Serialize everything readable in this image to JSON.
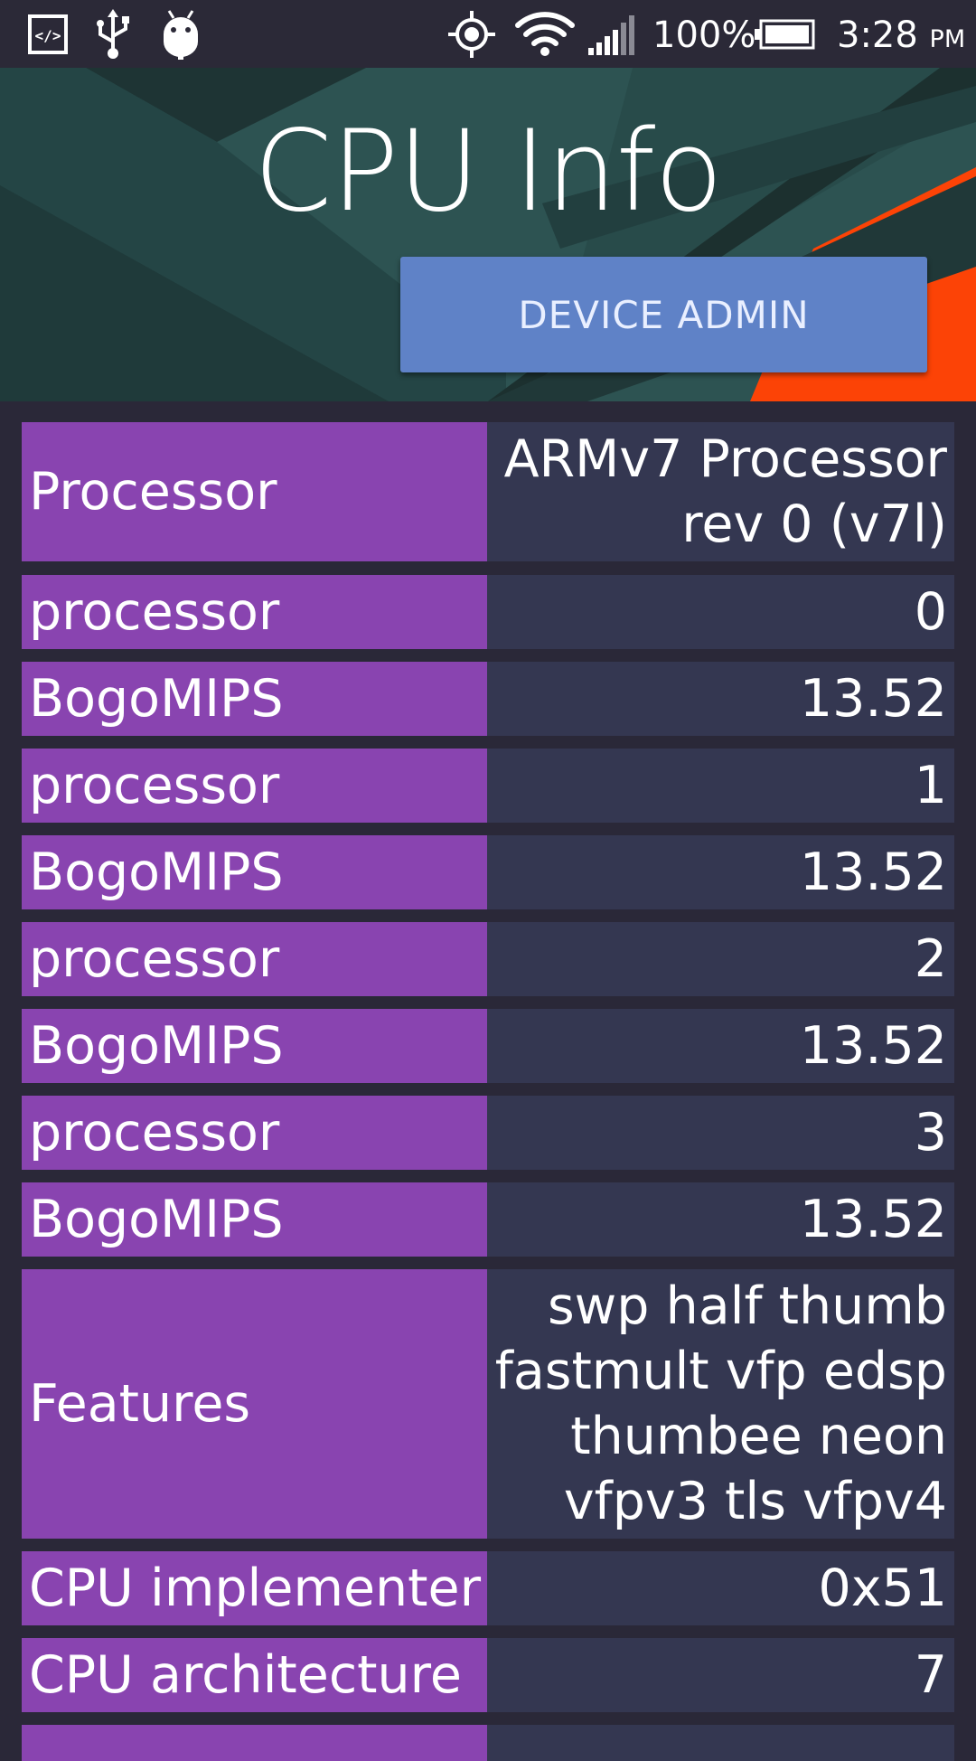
{
  "status_bar": {
    "icons": [
      "dev-code-icon",
      "usb-icon",
      "android-debug-icon",
      "gps-locate-icon",
      "wifi-icon",
      "cell-signal-icon",
      "battery-icon"
    ],
    "battery_percent": "100%",
    "time": "3:28",
    "time_suffix": "PM"
  },
  "header": {
    "title": "CPU Info",
    "device_admin_label": "DEVICE ADMIN",
    "colors": {
      "banner_dark": "#223f3f",
      "banner_mid": "#2d5352",
      "accent_orange": "#fc4306",
      "button": "#5f82c7"
    }
  },
  "table": {
    "colors": {
      "label_bg": "#8944b0",
      "value_bg": "#343751"
    },
    "rows": [
      {
        "label": "Processor",
        "value": "ARMv7 Processor rev 0 (v7l)"
      },
      {
        "label": "processor",
        "value": "0"
      },
      {
        "label": "BogoMIPS",
        "value": "13.52"
      },
      {
        "label": "processor",
        "value": "1"
      },
      {
        "label": "BogoMIPS",
        "value": "13.52"
      },
      {
        "label": "processor",
        "value": "2"
      },
      {
        "label": "BogoMIPS",
        "value": "13.52"
      },
      {
        "label": "processor",
        "value": "3"
      },
      {
        "label": "BogoMIPS",
        "value": "13.52"
      },
      {
        "label": "Features",
        "value": "swp half thumb fastmult vfp edsp thumbee neon vfpv3 tls vfpv4"
      },
      {
        "label": "CPU implementer",
        "value": "0x51"
      },
      {
        "label": "CPU architecture",
        "value": "7"
      }
    ]
  }
}
